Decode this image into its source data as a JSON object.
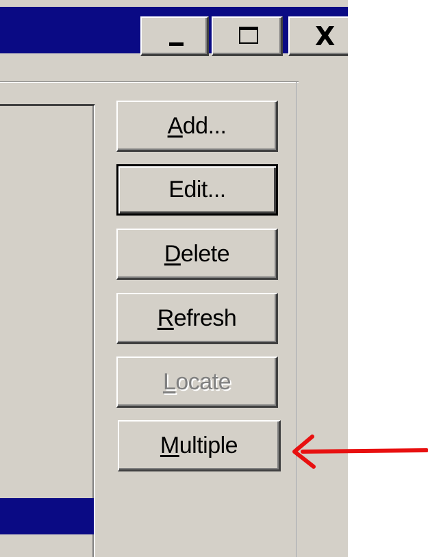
{
  "titlebar": {
    "minimize_label": "Minimize",
    "maximize_label": "Maximize",
    "close_label": "Close",
    "close_glyph": "X",
    "color": "#0a0a84"
  },
  "buttons": {
    "add": {
      "access_key": "A",
      "rest": "dd..."
    },
    "edit": {
      "label": "Edit..."
    },
    "delete": {
      "access_key": "D",
      "rest": "elete"
    },
    "refresh": {
      "access_key": "R",
      "rest": "efresh"
    },
    "locate": {
      "access_key": "L",
      "rest": "ocate",
      "enabled": false
    },
    "multiple": {
      "access_key": "M",
      "rest": "ultiple"
    }
  },
  "annotation": {
    "arrow_icon": "red-arrow-left",
    "color": "#e81010",
    "points_to": "multiple"
  },
  "colors": {
    "face": "#d4d0c8",
    "selection": "#0a0a84"
  }
}
